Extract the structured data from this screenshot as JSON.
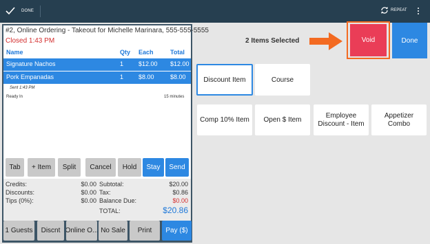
{
  "topbar": {
    "done_label": "DONE",
    "repeat_label": "REPEAT"
  },
  "ticket": {
    "header": "#2, Online Ordering - Takeout for Michelle Marinara, 555-555-5555",
    "status": "Closed 1:43 PM",
    "columns": {
      "name": "Name",
      "qty": "Qty",
      "each": "Each",
      "total": "Total"
    },
    "items": [
      {
        "name": "Signature Nachos",
        "qty": "1",
        "each": "$12.00",
        "total": "$12.00"
      },
      {
        "name": "Pork Empanadas",
        "qty": "1",
        "each": "$8.00",
        "total": "$8.00"
      }
    ],
    "sent": "Sent 1:43 PM",
    "ready_label": "Ready In",
    "ready_value": "15 minutes"
  },
  "actions": {
    "tab": "Tab",
    "add_item": "+ Item",
    "split": "Split",
    "cancel": "Cancel",
    "hold": "Hold",
    "stay": "Stay",
    "send": "Send"
  },
  "totals": {
    "credits_label": "Credits:",
    "credits": "$0.00",
    "discounts_label": "Discounts:",
    "discounts": "$0.00",
    "tips_label": "Tips (0%):",
    "tips": "$0.00",
    "subtotal_label": "Subtotal:",
    "subtotal": "$20.00",
    "tax_label": "Tax:",
    "tax": "$0.86",
    "balance_label": "Balance Due:",
    "balance": "$0.00",
    "total_label": "TOTAL:",
    "total": "$20.86"
  },
  "footer": {
    "guests": "1 Guests",
    "discnt": "Discnt",
    "online": "Online O...",
    "no_sale": "No Sale",
    "print": "Print",
    "pay": "Pay ($)"
  },
  "right": {
    "items_selected": "2 Items Selected",
    "void": "Void",
    "done": "Done",
    "tabs": [
      "Discount Item",
      "Course"
    ],
    "options": [
      "Comp 10% Item",
      "Open $ Item",
      "Employee Discount - Item",
      "Appetizer Combo"
    ]
  },
  "colors": {
    "accent": "#2d88e2",
    "void": "#ea3d57",
    "highlight": "#f36a21",
    "topbar": "#263f50"
  },
  "icons": [
    "check-icon",
    "repeat-icon",
    "more-vertical-icon",
    "arrow-right-icon"
  ]
}
